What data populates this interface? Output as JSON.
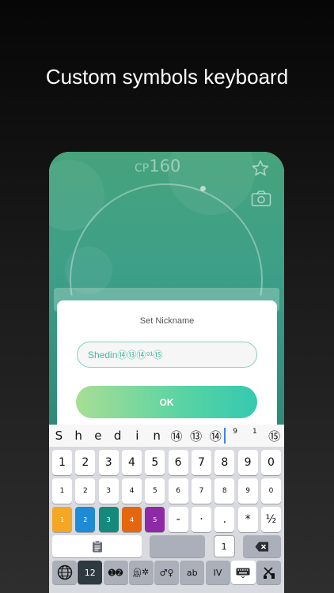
{
  "headline": "Custom symbols keyboard",
  "game": {
    "cp_label": "CP",
    "cp_value": "160",
    "icons": [
      "star-icon",
      "camera-icon"
    ]
  },
  "dialog": {
    "title": "Set Nickname",
    "nickname_value": "Shedin⑭⑬⑭⁹¹⑮",
    "ok_label": "OK"
  },
  "keyboard": {
    "suggestions": [
      "S",
      "h",
      "e",
      "d",
      "i",
      "n",
      "⑭",
      "⑬",
      "⑭",
      "9",
      "1",
      "⑮"
    ],
    "row1": [
      "1",
      "2",
      "3",
      "4",
      "5",
      "6",
      "7",
      "8",
      "9",
      "0"
    ],
    "row2": [
      "1",
      "2",
      "3",
      "4",
      "5",
      "6",
      "7",
      "8",
      "9",
      "0"
    ],
    "row3": [
      "1",
      "2",
      "3",
      "4",
      "5",
      "-",
      "·",
      ".",
      "*",
      "½"
    ],
    "row4": {
      "one": "1"
    },
    "bottom_row": {
      "globe": "globe-icon",
      "mode1": "12",
      "mode2": "➊➋",
      "mode3": "இ✲",
      "mode4": "♂♀",
      "mode5": "ab",
      "mode6": "IV"
    },
    "colors": {
      "color1": "#f5a623",
      "color2": "#1f8ad6",
      "color3": "#158a7b",
      "color4": "#e4670f",
      "color5": "#8e2aa5"
    }
  }
}
